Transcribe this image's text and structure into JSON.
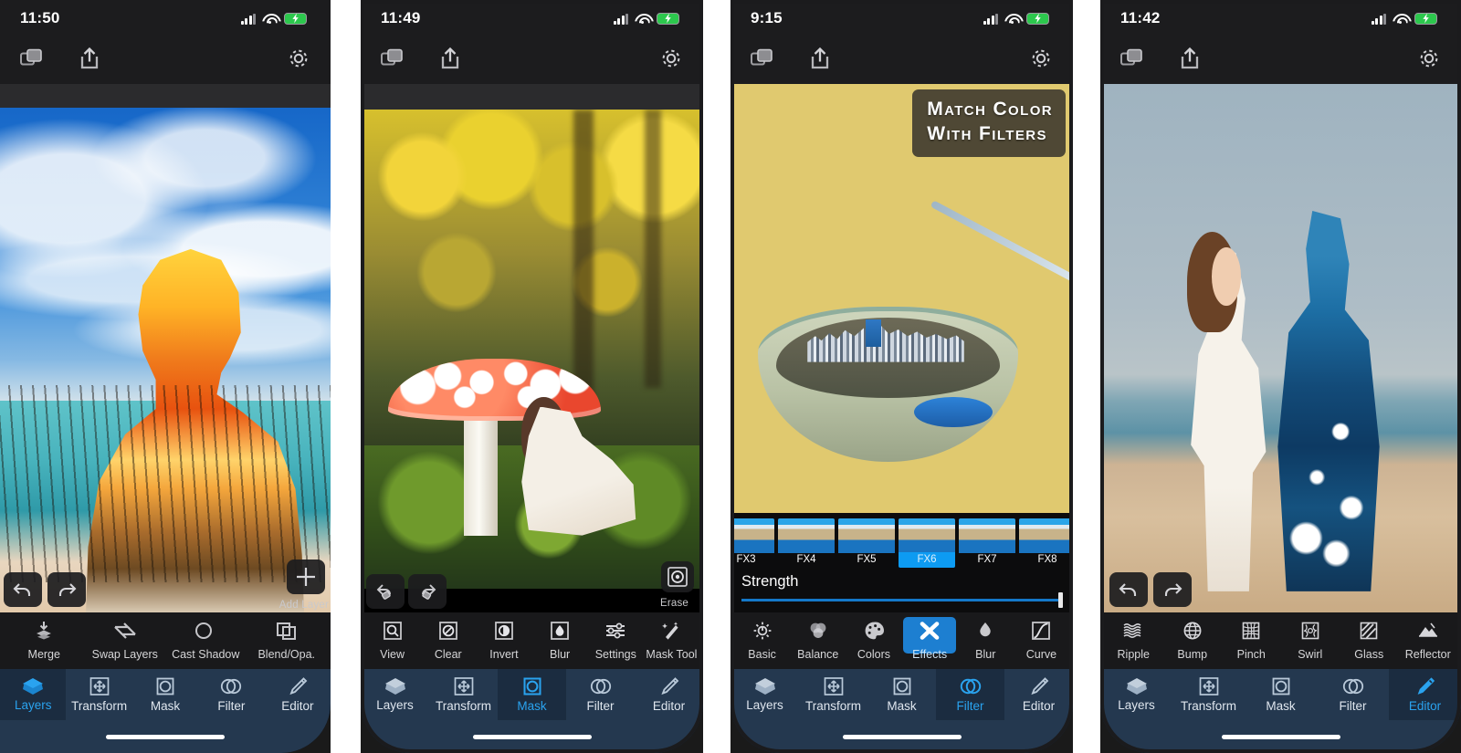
{
  "app": {
    "name": "Photo Layers Editor",
    "accent": "#2aa3ef",
    "nav_bg": "#24384f",
    "toolbar_bg": "#19191b"
  },
  "phones": [
    {
      "id": "phone-1",
      "status": {
        "time": "11:50",
        "signal": "cellular-bars-icon",
        "wifi": "wifi-icon",
        "battery": "battery-charging-icon"
      },
      "appbar": {
        "layers": "layers-stack-icon",
        "share": "share-export-icon",
        "settings": "gear-icon"
      },
      "canvas": {
        "description": "silhouette-double-exposure-sunset"
      },
      "float": {
        "undo": "undo-arrow-icon",
        "redo": "redo-arrow-icon",
        "action_icon": "plus-icon",
        "action_label": "Add Layer"
      },
      "tools": [
        {
          "label": "Merge",
          "icon": "merge-down-icon",
          "active": false
        },
        {
          "label": "Swap Layers",
          "icon": "swap-layers-icon",
          "active": false
        },
        {
          "label": "Cast Shadow",
          "icon": "cast-shadow-icon",
          "active": false
        },
        {
          "label": "Blend/Opa.",
          "icon": "blend-opacity-icon",
          "active": false
        }
      ],
      "nav": [
        {
          "label": "Layers",
          "icon": "layers-icon",
          "active": true
        },
        {
          "label": "Transform",
          "icon": "transform-icon",
          "active": false
        },
        {
          "label": "Mask",
          "icon": "mask-icon",
          "active": false
        },
        {
          "label": "Filter",
          "icon": "filter-icon",
          "active": false
        },
        {
          "label": "Editor",
          "icon": "pencil-icon",
          "active": false
        }
      ]
    },
    {
      "id": "phone-2",
      "status": {
        "time": "11:49",
        "signal": "cellular-bars-icon",
        "wifi": "wifi-icon",
        "battery": "battery-charging-icon"
      },
      "appbar": {
        "layers": "layers-stack-icon",
        "share": "share-export-icon",
        "settings": "gear-icon"
      },
      "canvas": {
        "description": "mushroom-forest-with-reading-woman"
      },
      "float": {
        "undo": "undo-mask-icon",
        "redo": "redo-mask-icon",
        "action_icon": "erase-target-icon",
        "action_label": "Erase"
      },
      "tools": [
        {
          "label": "View",
          "icon": "magnifier-icon",
          "active": false
        },
        {
          "label": "Clear",
          "icon": "clear-icon",
          "active": false
        },
        {
          "label": "Invert",
          "icon": "invert-icon",
          "active": false
        },
        {
          "label": "Blur",
          "icon": "blur-drop-icon",
          "active": false
        },
        {
          "label": "Settings",
          "icon": "sliders-icon",
          "active": false
        },
        {
          "label": "Mask Tool",
          "icon": "magic-wand-icon",
          "active": false
        }
      ],
      "nav": [
        {
          "label": "Layers",
          "icon": "layers-icon",
          "active": false
        },
        {
          "label": "Transform",
          "icon": "transform-icon",
          "active": false
        },
        {
          "label": "Mask",
          "icon": "mask-icon",
          "active": true
        },
        {
          "label": "Filter",
          "icon": "filter-icon",
          "active": false
        },
        {
          "label": "Editor",
          "icon": "pencil-icon",
          "active": false
        }
      ]
    },
    {
      "id": "phone-3",
      "status": {
        "time": "9:15",
        "signal": "cellular-bars-icon",
        "wifi": "wifi-icon",
        "battery": "battery-charging-icon"
      },
      "appbar": {
        "layers": "layers-stack-icon",
        "share": "share-export-icon",
        "settings": "gear-icon"
      },
      "canvas": {
        "description": "city-skyline-inside-cereal-bowl"
      },
      "banner": {
        "line1": "Match Color",
        "line2": "With Filters"
      },
      "filters": {
        "items": [
          {
            "label": "FX3",
            "selected": false
          },
          {
            "label": "FX4",
            "selected": false
          },
          {
            "label": "FX5",
            "selected": false
          },
          {
            "label": "FX6",
            "selected": true
          },
          {
            "label": "FX7",
            "selected": false
          },
          {
            "label": "FX8",
            "selected": false
          }
        ],
        "slider_label": "Strength",
        "slider_value": 100
      },
      "tools": [
        {
          "label": "Basic",
          "icon": "brightness-icon",
          "active": false
        },
        {
          "label": "Balance",
          "icon": "color-balance-icon",
          "active": false
        },
        {
          "label": "Colors",
          "icon": "palette-icon",
          "active": false
        },
        {
          "label": "Effects",
          "icon": "effects-cross-icon",
          "active": true
        },
        {
          "label": "Blur",
          "icon": "blur-drop-icon",
          "active": false
        },
        {
          "label": "Curve",
          "icon": "curve-icon",
          "active": false
        }
      ],
      "nav": [
        {
          "label": "Layers",
          "icon": "layers-icon",
          "active": false
        },
        {
          "label": "Transform",
          "icon": "transform-icon",
          "active": false
        },
        {
          "label": "Mask",
          "icon": "mask-icon",
          "active": false
        },
        {
          "label": "Filter",
          "icon": "filter-icon",
          "active": true
        },
        {
          "label": "Editor",
          "icon": "pencil-icon",
          "active": false
        }
      ]
    },
    {
      "id": "phone-4",
      "status": {
        "time": "11:42",
        "signal": "cellular-bars-icon",
        "wifi": "wifi-icon",
        "battery": "battery-charging-icon"
      },
      "appbar": {
        "layers": "layers-stack-icon",
        "share": "share-export-icon",
        "settings": "gear-icon"
      },
      "canvas": {
        "description": "beach-couple-groom-water-double-exposure"
      },
      "float": {
        "undo": "undo-arrow-icon",
        "redo": "redo-arrow-icon"
      },
      "tools": [
        {
          "label": "Ripple",
          "icon": "ripple-icon",
          "active": false
        },
        {
          "label": "Bump",
          "icon": "bump-icon",
          "active": false
        },
        {
          "label": "Pinch",
          "icon": "pinch-icon",
          "active": false
        },
        {
          "label": "Swirl",
          "icon": "swirl-icon",
          "active": false
        },
        {
          "label": "Glass",
          "icon": "glass-icon",
          "active": false
        },
        {
          "label": "Reflector",
          "icon": "reflector-icon",
          "active": false
        }
      ],
      "nav": [
        {
          "label": "Layers",
          "icon": "layers-icon",
          "active": false
        },
        {
          "label": "Transform",
          "icon": "transform-icon",
          "active": false
        },
        {
          "label": "Mask",
          "icon": "mask-icon",
          "active": false
        },
        {
          "label": "Filter",
          "icon": "filter-icon",
          "active": false
        },
        {
          "label": "Editor",
          "icon": "pencil-icon",
          "active": true
        }
      ]
    }
  ]
}
